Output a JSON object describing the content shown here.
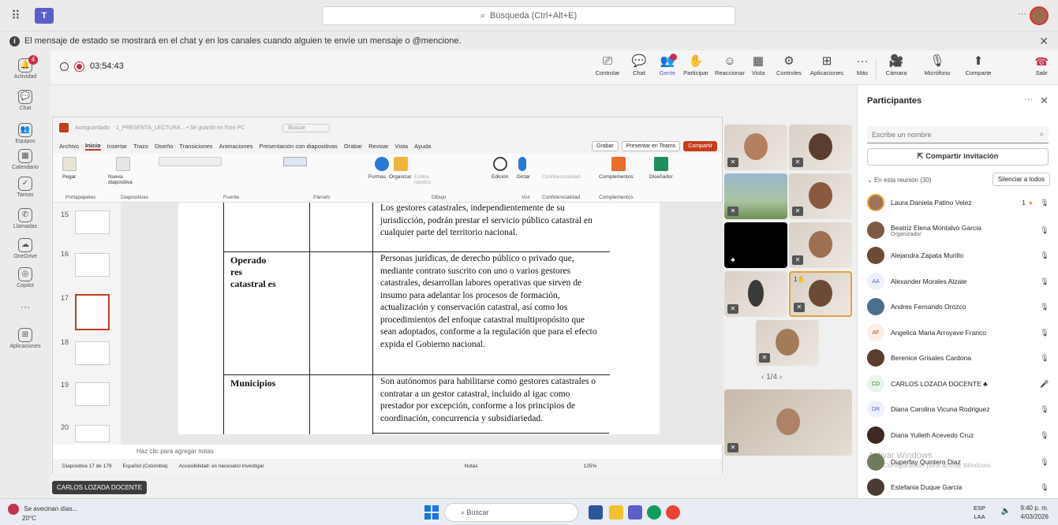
{
  "app": {
    "search_placeholder": "Búsqueda (Ctrl+Alt+E)",
    "more": "···",
    "logo": "T"
  },
  "notice": {
    "text": "El mensaje de estado se mostrará en el chat y en los canales cuando alguien te envíe un mensaje o @mencione.",
    "close": "✕"
  },
  "rail": {
    "items": [
      {
        "label": "Actividad",
        "icon": "bell-icon",
        "glyph": "🔔",
        "badge": "4"
      },
      {
        "label": "Chat",
        "icon": "chat-icon",
        "glyph": "💬"
      },
      {
        "label": "Equipos",
        "icon": "teams-icon",
        "glyph": "👥"
      },
      {
        "label": "Calendario",
        "icon": "calendar-icon",
        "glyph": "▦"
      },
      {
        "label": "Tareas",
        "icon": "tasks-icon",
        "glyph": "✓"
      },
      {
        "label": "Llamadas",
        "icon": "phone-icon",
        "glyph": "✆"
      },
      {
        "label": "OneDrive",
        "icon": "cloud-icon",
        "glyph": "☁"
      },
      {
        "label": "Copilot",
        "icon": "copilot-icon",
        "glyph": "◎"
      },
      {
        "label": "...",
        "icon": "more-icon",
        "glyph": "···"
      },
      {
        "label": "Aplicaciones",
        "icon": "apps-icon",
        "glyph": "⊞"
      }
    ]
  },
  "meeting": {
    "timer": "03:54:43",
    "tools": [
      {
        "label": "Controlar",
        "glyph": "⎚"
      },
      {
        "label": "Chat",
        "glyph": "💬"
      },
      {
        "label": "Gente",
        "glyph": "👥",
        "badge": true
      },
      {
        "label": "Participar",
        "glyph": "✋"
      },
      {
        "label": "Reaccionar",
        "glyph": "☺"
      },
      {
        "label": "Vista",
        "glyph": "▦"
      },
      {
        "label": "Controles",
        "glyph": "⚙"
      },
      {
        "label": "Aplicaciones",
        "glyph": "⊞"
      },
      {
        "label": "Más",
        "glyph": "···"
      }
    ],
    "camera": "Cámara",
    "mic": "Micrófono",
    "share": "Comparte",
    "leave": "Salir"
  },
  "ppt": {
    "autosave": "Autoguardado",
    "filename": "1_PRESENTA_LECTURA... • Se guardó en Este PC",
    "search": "Buscar",
    "menu": [
      "Archivo",
      "Inicio",
      "Insertar",
      "Trazo",
      "Diseño",
      "Transiciones",
      "Animaciones",
      "Presentación con diapositivas",
      "Grabar",
      "Revisar",
      "Vista",
      "Ayuda"
    ],
    "grabar_btn": "Grabar",
    "present_btn": "Presentar en Teams",
    "share_btn": "Compartir",
    "ribbon_groups": [
      "Portapapeles",
      "Diapositivas",
      "Fuente",
      "Párrafo",
      "Dibujo",
      "Voz",
      "Confidencialidad",
      "Complementos"
    ],
    "ribbon_labels": [
      "Pegar",
      "Nueva diapositiva",
      "Formas",
      "Organizar",
      "Estilos rápidos",
      "Edición",
      "Dictar",
      "Confidencialidad",
      "Complementos",
      "Diseñador"
    ],
    "thumb_numbers": [
      "15",
      "16",
      "17",
      "18",
      "19",
      "20"
    ],
    "slide": {
      "intro_text": "Los gestores catastrales, independientemente de su jurisdicción, podrán prestar el servicio público catastral en cualquier parte del territorio nacional.",
      "row1_term": "Operado res catastral es",
      "row1_text": "Personas jurídicas, de derecho público o privado que, mediante contrato suscrito con uno o varios gestores catastrales, desarrollan labores operativas que sirven de insumo para adelantar los procesos de formación, actualización y conservación catastral, así como los procedimientos del enfoque catastral multipropósito que sean adoptados, conforme a la regulación que para el efecto expida el Gobierno nacional.",
      "row2_term": "Municipios",
      "row2_text": "Son autónomos para habilitarse como gestores catastrales o contratar a un gestor catastral, incluido al igac como prestador por excepción, conforme a los principios de coordinación, concurrencia y subsidiariedad."
    },
    "notes_placeholder": "Haz clic para agregar notas",
    "status": {
      "slide_count": "Diapositiva 17 de 179",
      "language": "Español (Colombia)",
      "accessibility": "Accesibilidad: es necesario investigar",
      "notes": "Notas",
      "zoom": "125%"
    }
  },
  "presenter_tag": "CARLOS LOZADA DOCENTE",
  "video": {
    "pager": "1/4",
    "raised_count": "1"
  },
  "participants": {
    "title": "Participantes",
    "search_placeholder": "Escribe un nombre",
    "invite": "Compartir invitación",
    "section": "En esta reunión (30)",
    "silence_all": "Silenciar a todos",
    "list": [
      {
        "name": "Laura Daniela Patino Velez",
        "extra": "1",
        "initials": ""
      },
      {
        "name": "Beatriz Elena Montalvo Garcia",
        "role": "Organizador",
        "initials": ""
      },
      {
        "name": "Alejandra Zapata Murillo",
        "initials": ""
      },
      {
        "name": "Alexander Morales Alzate",
        "initials": "AA"
      },
      {
        "name": "Andres Fernando Orozco",
        "initials": ""
      },
      {
        "name": "Angelica Maria Arroyave Franco",
        "initials": "AF"
      },
      {
        "name": "Berenice Grisales Cardona",
        "initials": ""
      },
      {
        "name": "CARLOS LOZADA DOCENTE",
        "initials": "CD",
        "presenting": true
      },
      {
        "name": "Diana Carolina Vicuna Rodriguez",
        "initials": "DR"
      },
      {
        "name": "Diana Yulieth Acevedo Cruz",
        "initials": ""
      },
      {
        "name": "Duperfay Quintero Diaz",
        "initials": ""
      },
      {
        "name": "Estefania Duque Garcia",
        "initials": ""
      }
    ]
  },
  "watermark": {
    "line1": "Activar Windows",
    "line2": "Ve a Configuración para activar Windows."
  },
  "taskbar": {
    "weather_title": "Se avecinan días...",
    "weather_temp": "20°C",
    "search": "Buscar",
    "lang_top": "ESP",
    "lang_bottom": "LAA",
    "time": "9:40 p. m.",
    "date": "4/03/2026"
  },
  "colors": {
    "teams_purple": "#5b5fc7",
    "ppt_orange": "#c43e1c",
    "alert_red": "#c4314b",
    "raised_hand": "#e3a33a"
  }
}
